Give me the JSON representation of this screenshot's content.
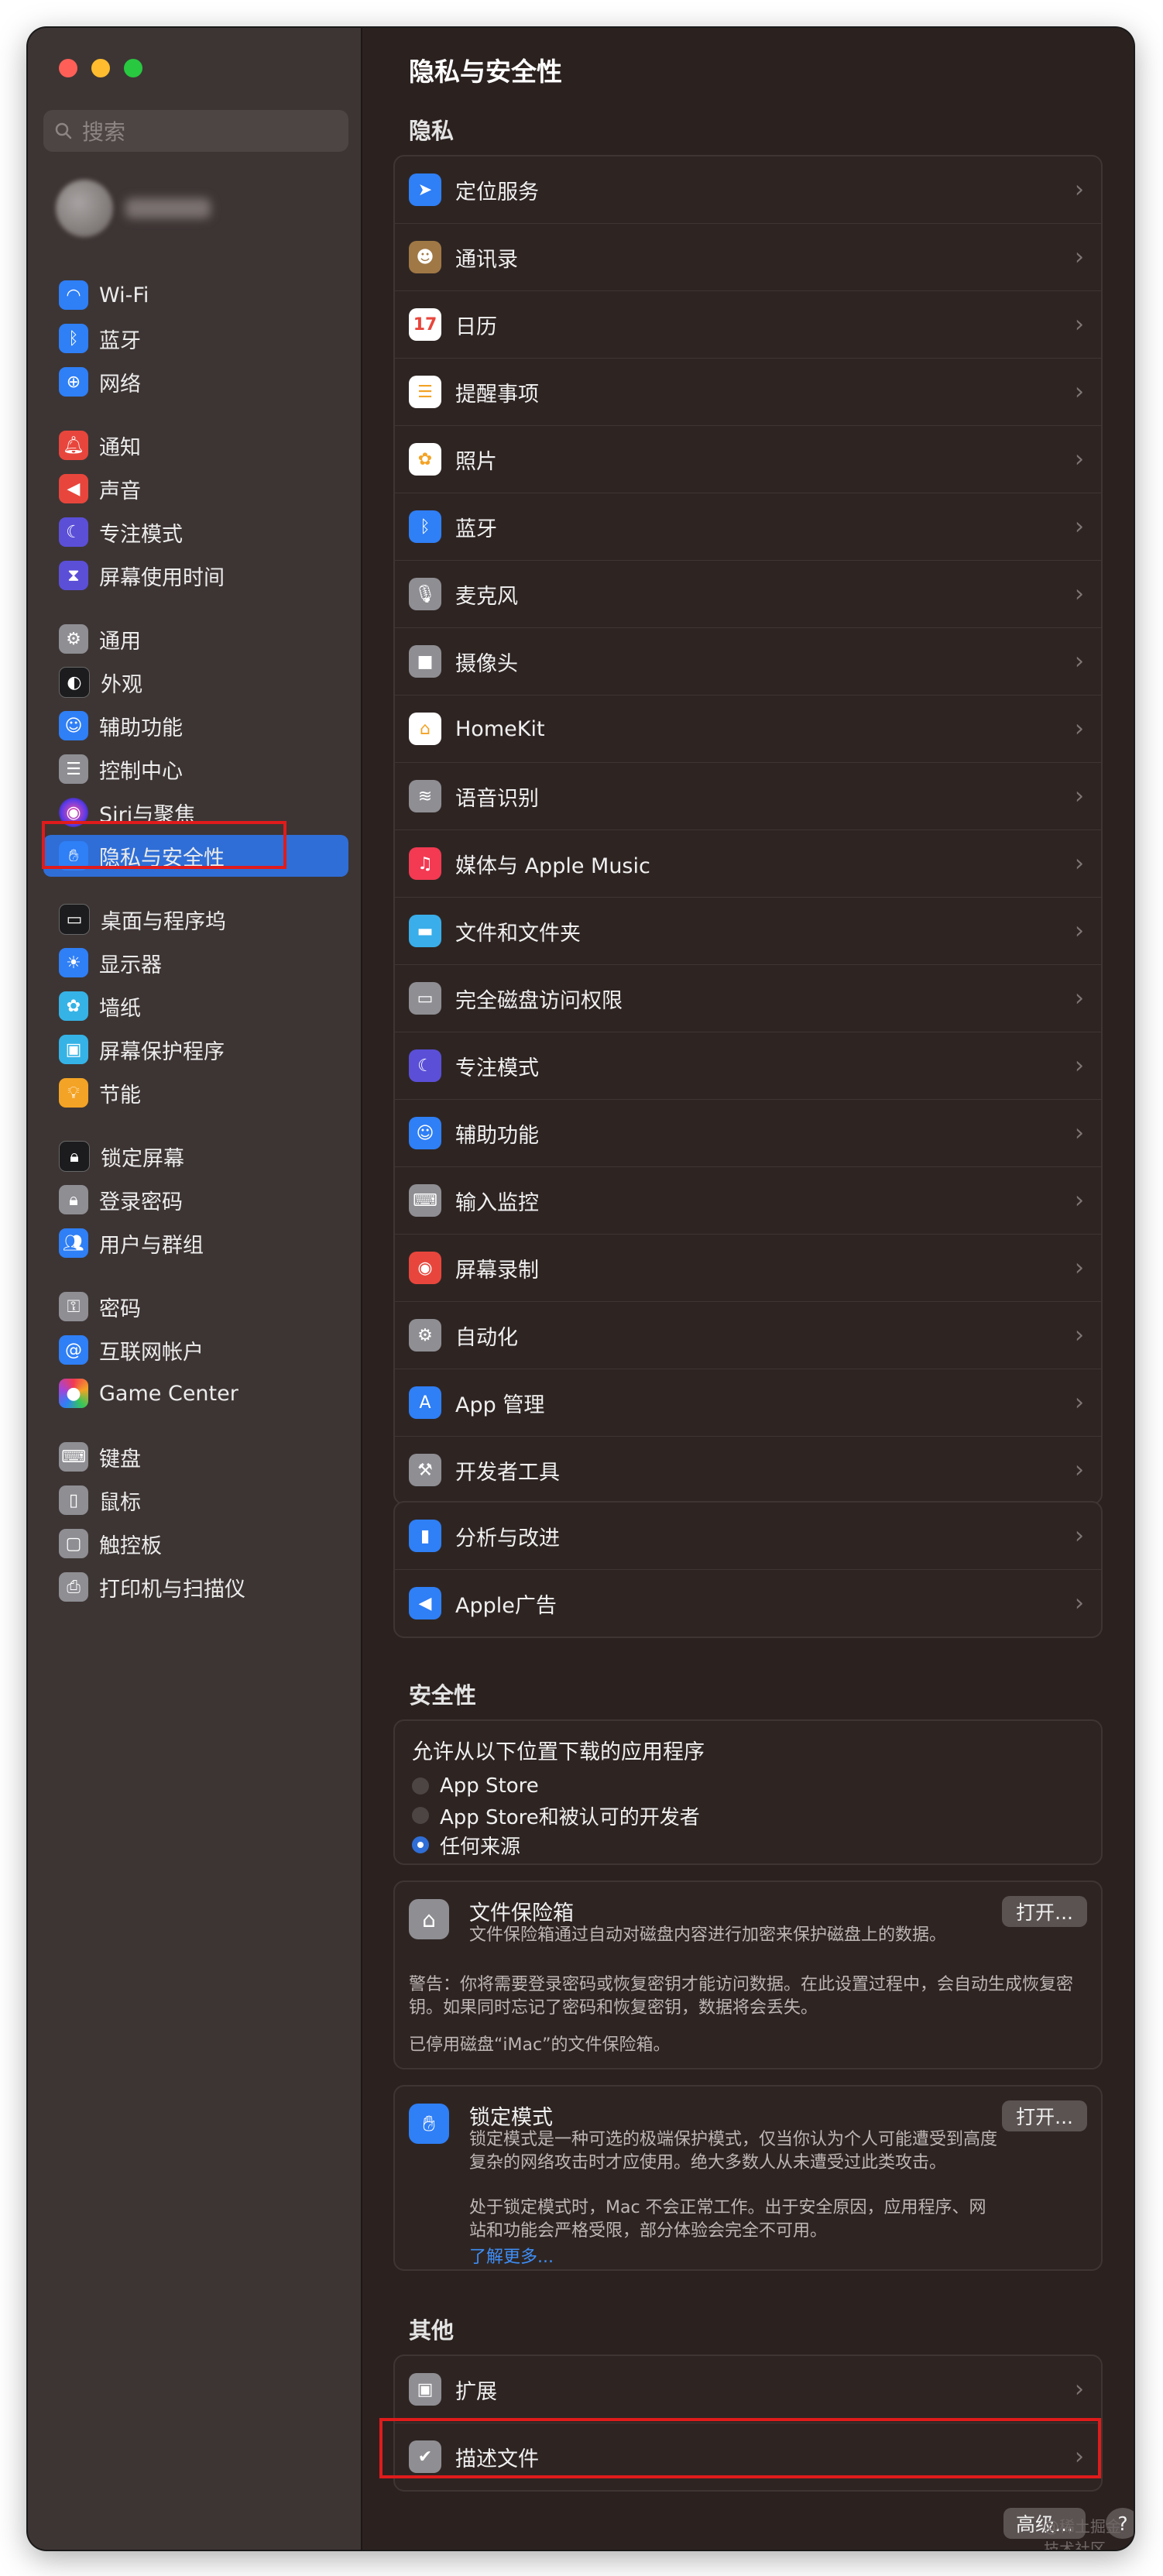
{
  "window_controls": {
    "close_color": "#ff5f57",
    "minimize_color": "#febc2e",
    "zoom_color": "#28c840"
  },
  "sidebar": {
    "search_placeholder": "搜索",
    "items": [
      {
        "label": "Wi-Fi",
        "icon": "wifi-icon",
        "color": "#2f7ff6"
      },
      {
        "label": "蓝牙",
        "icon": "bluetooth-icon",
        "color": "#2f7ff6"
      },
      {
        "label": "网络",
        "icon": "globe-icon",
        "color": "#2f7ff6"
      },
      {
        "label": "通知",
        "icon": "bell-icon",
        "color": "#e8463c"
      },
      {
        "label": "声音",
        "icon": "speaker-icon",
        "color": "#e8463c"
      },
      {
        "label": "专注模式",
        "icon": "moon-icon",
        "color": "#5b4fd8"
      },
      {
        "label": "屏幕使用时间",
        "icon": "hourglass-icon",
        "color": "#5b4fd8"
      },
      {
        "label": "通用",
        "icon": "gear-icon",
        "color": "#8e8e93"
      },
      {
        "label": "外观",
        "icon": "appearance-icon",
        "color": "#1c1c1e"
      },
      {
        "label": "辅助功能",
        "icon": "accessibility-icon",
        "color": "#2f7ff6"
      },
      {
        "label": "控制中心",
        "icon": "switches-icon",
        "color": "#8e8e93"
      },
      {
        "label": "Siri与聚焦",
        "icon": "siri-icon",
        "color": "#a344d9"
      },
      {
        "label": "隐私与安全性",
        "icon": "hand-icon",
        "color": "#2f7ff6"
      },
      {
        "label": "桌面与程序坞",
        "icon": "dock-icon",
        "color": "#1c1c1e"
      },
      {
        "label": "显示器",
        "icon": "sun-icon",
        "color": "#2f7ff6"
      },
      {
        "label": "墙纸",
        "icon": "flower-icon",
        "color": "#35b3e6"
      },
      {
        "label": "屏幕保护程序",
        "icon": "screensaver-icon",
        "color": "#35b3e6"
      },
      {
        "label": "节能",
        "icon": "bulb-icon",
        "color": "#f3a325"
      },
      {
        "label": "锁定屏幕",
        "icon": "lock-icon",
        "color": "#1c1c1e"
      },
      {
        "label": "登录密码",
        "icon": "lock-icon",
        "color": "#8e8e93"
      },
      {
        "label": "用户与群组",
        "icon": "users-icon",
        "color": "#2f7ff6"
      },
      {
        "label": "密码",
        "icon": "key-icon",
        "color": "#8e8e93"
      },
      {
        "label": "互联网帐户",
        "icon": "at-icon",
        "color": "#2f7ff6"
      },
      {
        "label": "Game Center",
        "icon": "gamecenter-icon",
        "color": "#ffffff"
      },
      {
        "label": "键盘",
        "icon": "keyboard-icon",
        "color": "#8e8e93"
      },
      {
        "label": "鼠标",
        "icon": "mouse-icon",
        "color": "#8e8e93"
      },
      {
        "label": "触控板",
        "icon": "trackpad-icon",
        "color": "#8e8e93"
      },
      {
        "label": "打印机与扫描仪",
        "icon": "printer-icon",
        "color": "#8e8e93"
      }
    ],
    "active_index": 12
  },
  "main": {
    "title": "隐私与安全性",
    "privacy": {
      "heading": "隐私",
      "items": [
        {
          "label": "定位服务",
          "icon": "location-arrow-icon",
          "color": "#2f7ff6"
        },
        {
          "label": "通讯录",
          "icon": "contacts-icon",
          "color": "#a07845"
        },
        {
          "label": "日历",
          "icon": "calendar-icon",
          "color": "#ffffff"
        },
        {
          "label": "提醒事项",
          "icon": "reminders-icon",
          "color": "#ffffff"
        },
        {
          "label": "照片",
          "icon": "photos-icon",
          "color": "#ffffff"
        },
        {
          "label": "蓝牙",
          "icon": "bluetooth-icon",
          "color": "#2f7ff6"
        },
        {
          "label": "麦克风",
          "icon": "microphone-icon",
          "color": "#8e8e93"
        },
        {
          "label": "摄像头",
          "icon": "camera-icon",
          "color": "#8e8e93"
        },
        {
          "label": "HomeKit",
          "icon": "home-icon",
          "color": "#ffffff"
        },
        {
          "label": "语音识别",
          "icon": "waveform-icon",
          "color": "#8e8e93"
        },
        {
          "label": "媒体与 Apple Music",
          "icon": "music-icon",
          "color": "#f33a52"
        },
        {
          "label": "文件和文件夹",
          "icon": "folder-icon",
          "color": "#3aaeea"
        },
        {
          "label": "完全磁盘访问权限",
          "icon": "disk-icon",
          "color": "#8e8e93"
        },
        {
          "label": "专注模式",
          "icon": "moon-icon",
          "color": "#5b4fd8"
        },
        {
          "label": "辅助功能",
          "icon": "accessibility-icon",
          "color": "#2f7ff6"
        },
        {
          "label": "输入监控",
          "icon": "keyboard-icon",
          "color": "#8e8e93"
        },
        {
          "label": "屏幕录制",
          "icon": "record-icon",
          "color": "#e8463c"
        },
        {
          "label": "自动化",
          "icon": "gears-icon",
          "color": "#8e8e93"
        },
        {
          "label": "App 管理",
          "icon": "appstore-icon",
          "color": "#2f7ff6"
        },
        {
          "label": "开发者工具",
          "icon": "hammer-icon",
          "color": "#8e8e93"
        }
      ]
    },
    "analytics": {
      "items": [
        {
          "label": "分析与改进",
          "icon": "chart-icon",
          "color": "#2f7ff6"
        },
        {
          "label": "Apple广告",
          "icon": "megaphone-icon",
          "color": "#2f7ff6"
        }
      ]
    },
    "security": {
      "heading": "安全性",
      "download_title": "允许从以下位置下载的应用程序",
      "options": [
        "App Store",
        "App Store和被认可的开发者",
        "任何来源"
      ],
      "selected_option": 2,
      "filevault": {
        "title": "文件保险箱",
        "description": "文件保险箱通过自动对磁盘内容进行加密来保护磁盘上的数据。",
        "button": "打开...",
        "warning": "警告：你将需要登录密码或恢复密钥才能访问数据。在此设置过程中，会自动生成恢复密钥。如果同时忘记了密码和恢复密钥，数据将会丢失。",
        "status": "已停用磁盘“iMac”的文件保险箱。"
      },
      "lockdown": {
        "title": "锁定模式",
        "description": "锁定模式是一种可选的极端保护模式，仅当你认为个人可能遭受到高度复杂的网络攻击时才应使用。绝大多数人从未遭受过此类攻击。",
        "button": "打开...",
        "note": "处于锁定模式时，Mac 不会正常工作。出于安全原因，应用程序、网站和功能会严格受限，部分体验会完全不可用。",
        "link": "了解更多..."
      }
    },
    "other": {
      "heading": "其他",
      "items": [
        {
          "label": "扩展",
          "icon": "extension-icon",
          "color": "#8e8e93"
        },
        {
          "label": "描述文件",
          "icon": "profile-check-icon",
          "color": "#8e8e93"
        }
      ]
    },
    "advanced_button": "高级...",
    "help_button": "?",
    "watermark": "@稀土掘金技术社区"
  }
}
